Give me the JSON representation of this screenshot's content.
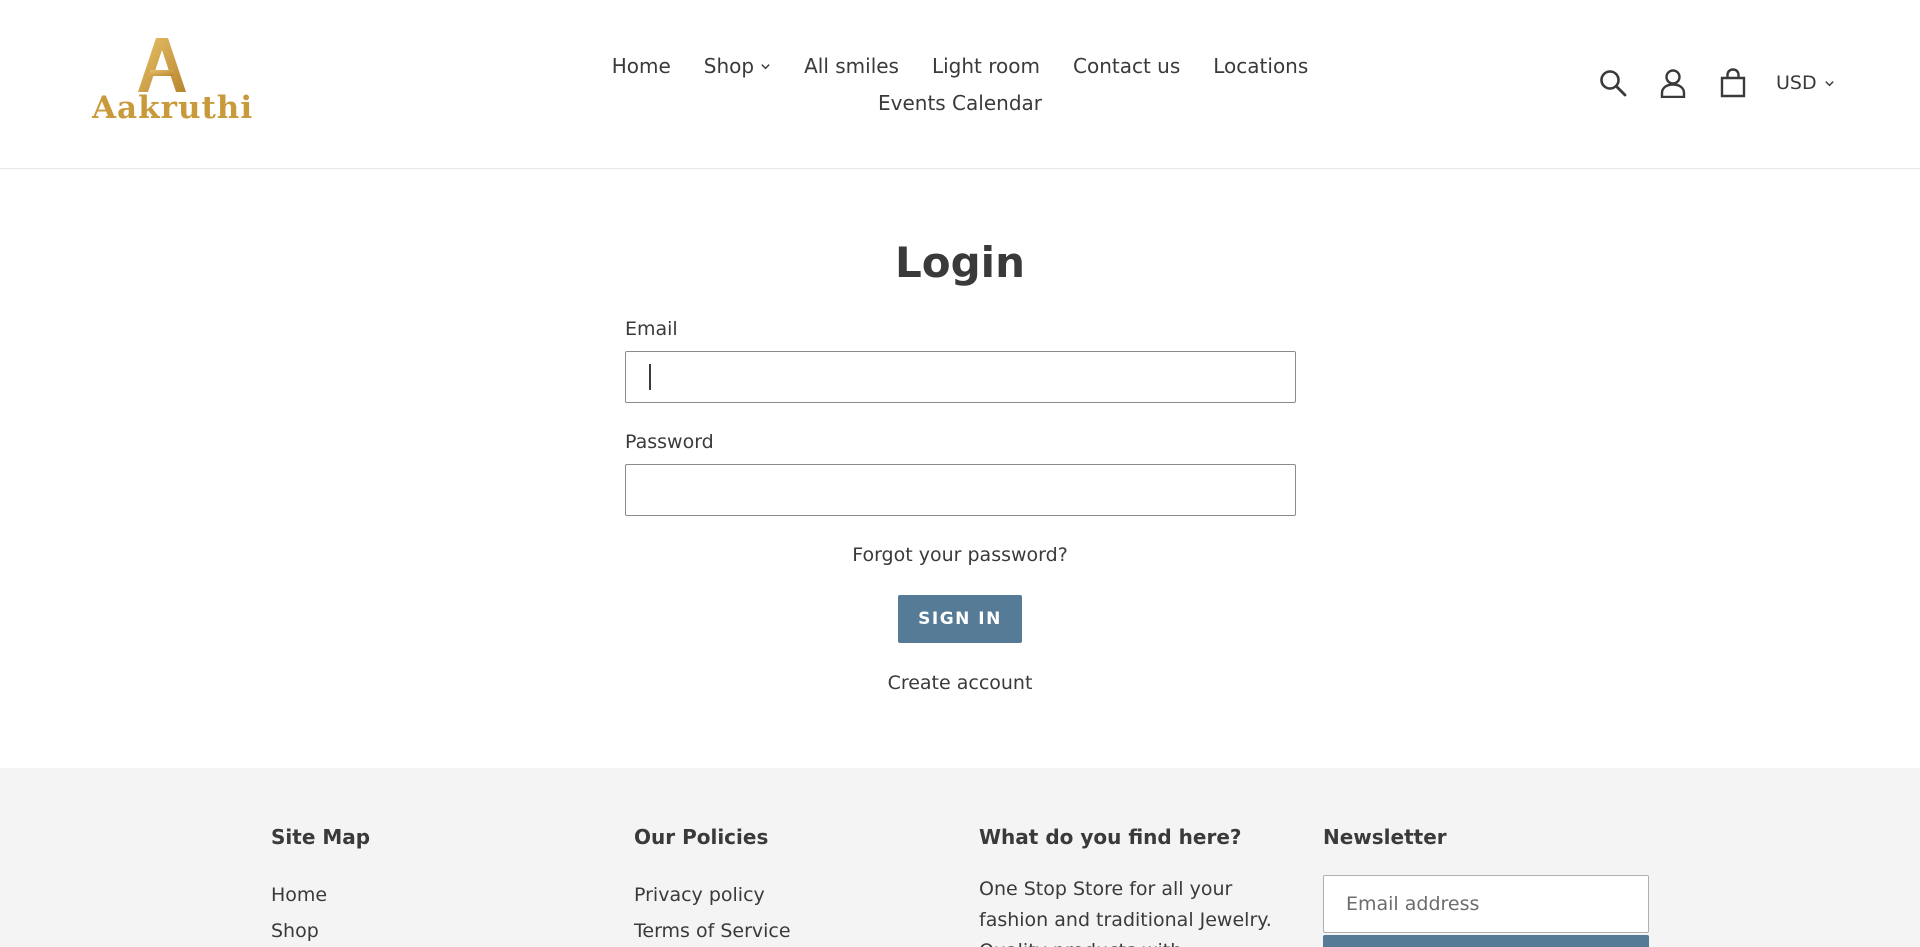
{
  "brand": {
    "logo_text": "Aakruthi",
    "logo_color": "#c99a3c"
  },
  "nav": {
    "row1": [
      {
        "label": "Home",
        "has_dropdown": false
      },
      {
        "label": "Shop",
        "has_dropdown": true
      },
      {
        "label": "All smiles",
        "has_dropdown": false
      },
      {
        "label": "Light room",
        "has_dropdown": false
      },
      {
        "label": "Contact us",
        "has_dropdown": false
      },
      {
        "label": "Locations",
        "has_dropdown": false
      }
    ],
    "row2": [
      {
        "label": "Events Calendar",
        "has_dropdown": false
      }
    ]
  },
  "header_icons": {
    "search": "search-icon",
    "account": "account-icon",
    "cart": "cart-icon"
  },
  "currency": {
    "selected": "USD"
  },
  "login": {
    "title": "Login",
    "email_label": "Email",
    "email_value": "",
    "password_label": "Password",
    "password_value": "",
    "forgot_link": "Forgot your password?",
    "sign_in_button": "SIGN IN",
    "create_account_link": "Create account"
  },
  "footer": {
    "site_map": {
      "heading": "Site Map",
      "links": [
        "Home",
        "Shop"
      ]
    },
    "policies": {
      "heading": "Our Policies",
      "links": [
        "Privacy policy",
        "Terms of Service"
      ]
    },
    "about": {
      "heading": "What do you find here?",
      "text": "One Stop Store for all your fashion and traditional Jewelry. Quality products with"
    },
    "newsletter": {
      "heading": "Newsletter",
      "placeholder": "Email address"
    }
  },
  "colors": {
    "accent": "#557b97",
    "text": "#3a3a3a",
    "footer_bg": "#f4f4f4"
  }
}
